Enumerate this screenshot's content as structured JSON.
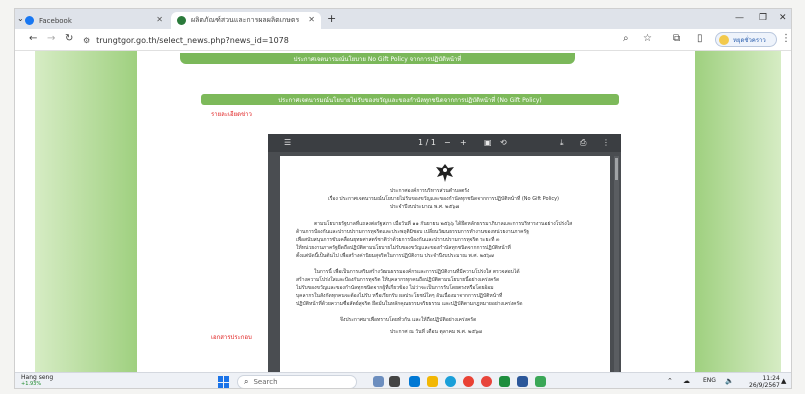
{
  "browser": {
    "tabs": [
      {
        "title": "Facebook",
        "active": false,
        "icon": "facebook-icon",
        "color": "#1877f2"
      },
      {
        "title": "ผลิตภัณฑ์สวนและการผลผลิตเกษตร",
        "active": true,
        "icon": "site-icon",
        "color": "#2b7a3b"
      }
    ],
    "url": "trungtgor.go.th/select_news.php?news_id=1078",
    "profile_label": "หยุดชั่วคราว"
  },
  "page": {
    "banner_top": "ประกาศเจตนารมณ์นโยบาย No Gift Policy จากการปฏิบัติหน้าที่",
    "banner_main": "ประกาศเจตนารมณ์นโยบายไม่รับของขวัญและของกำนัลทุกชนิดจากการปฏิบัติหน้าที่ (No Gift Policy)",
    "label_top": "รายละเอียดข่าว",
    "label_bottom": "เอกสารประกอบ",
    "accent": "#7bb85a"
  },
  "pdf": {
    "page_indicator": "1 / 1",
    "lines": [
      "ประกาศองค์การบริหารส่วนตำบลตรัง",
      "เรื่อง ประกาศเจตนารมณ์นโยบายไม่รับของขวัญและของกำนัลทุกชนิดจากการปฏิบัติหน้าที่ (No Gift Policy)",
      "ประจำปีงบประมาณ พ.ศ. ๒๕๖๗",
      "ตามนโยบายรัฐบาลที่แถลงต่อรัฐสภา เมื่อวันที่ ๑๑ กันยายน ๒๕๖๖ ได้ยึดหลักธรรมาภิบาลและการบริหารงานอย่างโปร่งใส",
      "ด้านการป้องกันและปราบปรามการทุจริตและประพฤติมิชอบ เปลี่ยนวัฒนธรรมการทำงานของหน่วยงานภาครัฐ",
      "เพื่อสนับสนุนการขับเคลื่อนยุทธศาสตร์ชาติว่าด้วยการป้องกันและปราบปรามการทุจริต ระยะที่ ๓",
      "ให้หน่วยงานภาครัฐยึดถือปฏิบัติตามนโยบายไม่รับของขวัญและของกำนัลทุกชนิดจากการปฏิบัติหน้าที่",
      "ตั้งแต่บัดนี้เป็นต้นไป เพื่อสร้างค่านิยมสุจริตในการปฏิบัติงาน ประจำปีงบประมาณ พ.ศ. ๒๕๖๗",
      "ในการนี้ เพื่อเป็นการเสริมสร้างวัฒนธรรมองค์กรและการปฏิบัติงานที่มีความโปร่งใส ตรวจสอบได้",
      "สร้างความโปร่งใสและป้องกันการทุจริต ให้บุคลากรทุกคนถือปฏิบัติตามนโยบายนี้อย่างเคร่งครัด",
      "ไม่รับของขวัญและของกำนัลทุกชนิดจากผู้ที่เกี่ยวข้อง ไม่ว่าจะเป็นการรับโดยตรงหรือโดยอ้อม",
      "บุคลากรในสังกัดทุกคนจะต้องไม่รับ หรือเรียกรับ ผลประโยชน์ใดๆ อันเนื่องมาจากการปฏิบัติหน้าที่",
      "ปฏิบัติหน้าที่ด้วยความซื่อสัตย์สุจริต ยึดมั่นในหลักคุณธรรมจริยธรรม และปฏิบัติตามกฎหมายอย่างเคร่งครัด",
      "จึงประกาศมาเพื่อทราบโดยทั่วกัน และให้ถือปฏิบัติอย่างเคร่งครัด",
      "ประกาศ ณ วันที่   เดือน ตุลาคม  พ.ศ. ๒๕๖๗"
    ]
  },
  "taskbar": {
    "weather_name": "Hang seng",
    "weather_value": "+1.93%",
    "search_placeholder": "Search",
    "lang": "ENG",
    "time": "11:24",
    "date": "26/9/2567"
  }
}
